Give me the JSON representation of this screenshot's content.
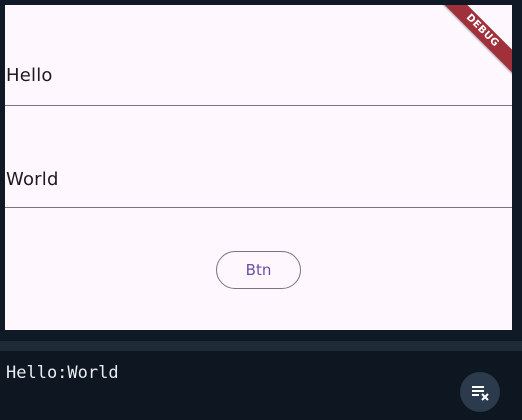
{
  "app": {
    "field_1": {
      "value": "Hello"
    },
    "field_2": {
      "value": "World"
    },
    "button": {
      "label": "Btn"
    },
    "debug_banner": {
      "label": "DEBUG"
    }
  },
  "console": {
    "output": "Hello:World",
    "clear_button_icon": "clear-all-icon"
  },
  "colors": {
    "surface": "#fef7fe",
    "text": "#1d1b20",
    "divider": "#7a747e",
    "button_text": "#6750a4",
    "button_border": "#79747e",
    "debug_ribbon": "#a0303a",
    "console_bg": "#0d1621",
    "console_text": "#e8edf2",
    "fab_bg": "#2b3b4d"
  }
}
